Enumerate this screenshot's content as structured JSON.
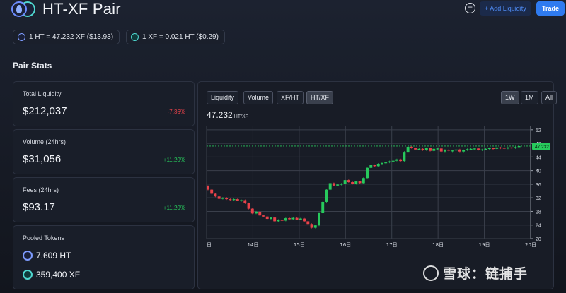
{
  "header": {
    "title": "HT-XF Pair",
    "add_liquidity_label": "+ Add Liquidity",
    "trade_label": "Trade",
    "plus_symbol": "+"
  },
  "rates": {
    "ht_to_xf": "1 HT = 47.232 XF ($13.93)",
    "xf_to_ht": "1 XF = 0.021 HT ($0.29)"
  },
  "section_title": "Pair Stats",
  "stats": {
    "total_liquidity": {
      "label": "Total Liquidity",
      "value": "$212,037",
      "change": "-7.36%"
    },
    "volume": {
      "label": "Volume (24hrs)",
      "value": "$31,056",
      "change": "+11.20%"
    },
    "fees": {
      "label": "Fees (24hrs)",
      "value": "$93.17",
      "change": "+11.20%"
    },
    "pooled": {
      "label": "Pooled Tokens",
      "ht": "7,609 HT",
      "xf": "359,400 XF"
    }
  },
  "chart_tabs": [
    "Liquidity",
    "Volume",
    "XF/HT",
    "HT/XF"
  ],
  "active_tab": "HT/XF",
  "range_tabs": [
    "1W",
    "1M",
    "All"
  ],
  "active_range": "1W",
  "price": {
    "value": "47.232",
    "unit": "HT/XF"
  },
  "watermark": "雪球：链捕手",
  "colors": {
    "up": "#27c95c",
    "down": "#e8424a",
    "accent": "#2f7bf0",
    "current_price": "#27c95c"
  },
  "chart_data": {
    "type": "candlestick",
    "x_ticks": [
      "日",
      "14日",
      "15日",
      "16日",
      "17日",
      "18日",
      "19日",
      "20日"
    ],
    "y_ticks": [
      20,
      24,
      28,
      32,
      36,
      40,
      44,
      48,
      52
    ],
    "ylim": [
      20,
      53
    ],
    "current_price_label": "47.232",
    "current_price": 47.2,
    "grid": true,
    "candles": [
      [
        0.0,
        35.5,
        34.4
      ],
      [
        0.08,
        34.4,
        33.2
      ],
      [
        0.16,
        33.2,
        32.4
      ],
      [
        0.24,
        32.4,
        31.7
      ],
      [
        0.32,
        31.7,
        32.0
      ],
      [
        0.4,
        32.0,
        31.6
      ],
      [
        0.48,
        31.6,
        31.4
      ],
      [
        0.56,
        31.4,
        31.6
      ],
      [
        0.64,
        31.6,
        31.2
      ],
      [
        0.72,
        31.2,
        31.3
      ],
      [
        0.8,
        31.3,
        30.4
      ],
      [
        0.88,
        30.4,
        28.8
      ],
      [
        0.96,
        28.8,
        27.4
      ],
      [
        1.04,
        27.4,
        27.9
      ],
      [
        1.12,
        27.9,
        26.8
      ],
      [
        1.2,
        26.8,
        26.5
      ],
      [
        1.28,
        26.5,
        25.8
      ],
      [
        1.36,
        25.8,
        26.2
      ],
      [
        1.44,
        26.2,
        25.1
      ],
      [
        1.52,
        25.1,
        25.5
      ],
      [
        1.6,
        25.5,
        25.3
      ],
      [
        1.68,
        25.3,
        26.0
      ],
      [
        1.76,
        26.0,
        25.7
      ],
      [
        1.84,
        25.7,
        26.1
      ],
      [
        1.92,
        26.1,
        25.6
      ],
      [
        2.0,
        25.6,
        25.9
      ],
      [
        2.08,
        25.9,
        25.1
      ],
      [
        2.16,
        25.1,
        24.3
      ],
      [
        2.24,
        24.3,
        23.2
      ],
      [
        2.32,
        23.2,
        23.9
      ],
      [
        2.4,
        23.9,
        27.6
      ],
      [
        2.48,
        27.6,
        30.8
      ],
      [
        2.56,
        30.8,
        34.4
      ],
      [
        2.64,
        34.4,
        36.3
      ],
      [
        2.72,
        36.3,
        35.6
      ],
      [
        2.8,
        35.6,
        35.9
      ],
      [
        2.88,
        35.9,
        36.1
      ],
      [
        2.96,
        36.1,
        37.2
      ],
      [
        3.04,
        37.2,
        36.6
      ],
      [
        3.12,
        36.6,
        36.1
      ],
      [
        3.2,
        36.1,
        36.8
      ],
      [
        3.28,
        36.8,
        36.3
      ],
      [
        3.36,
        36.3,
        37.8
      ],
      [
        3.44,
        37.8,
        40.8
      ],
      [
        3.52,
        40.8,
        41.6
      ],
      [
        3.6,
        41.6,
        41.3
      ],
      [
        3.68,
        41.3,
        42.0
      ],
      [
        3.76,
        42.0,
        42.2
      ],
      [
        3.84,
        42.2,
        42.4
      ],
      [
        3.92,
        42.4,
        42.7
      ],
      [
        4.0,
        42.7,
        42.9
      ],
      [
        4.08,
        42.9,
        43.3
      ],
      [
        4.16,
        43.3,
        42.8
      ],
      [
        4.24,
        42.8,
        45.5
      ],
      [
        4.32,
        45.5,
        47.0
      ],
      [
        4.4,
        47.0,
        46.6
      ],
      [
        4.48,
        46.6,
        46.2
      ],
      [
        4.56,
        46.2,
        46.4
      ],
      [
        4.64,
        46.4,
        46.0
      ],
      [
        4.72,
        46.0,
        46.6
      ],
      [
        4.8,
        46.6,
        45.8
      ],
      [
        4.88,
        45.8,
        46.4
      ],
      [
        4.96,
        46.4,
        46.5
      ],
      [
        5.04,
        46.5,
        45.6
      ],
      [
        5.12,
        45.6,
        46.1
      ],
      [
        5.2,
        46.1,
        45.9
      ],
      [
        5.28,
        45.9,
        45.9
      ],
      [
        5.36,
        45.9,
        46.2
      ],
      [
        5.44,
        46.2,
        45.6
      ],
      [
        5.52,
        45.6,
        46.0
      ],
      [
        5.6,
        46.0,
        46.3
      ],
      [
        5.68,
        46.3,
        46.4
      ],
      [
        5.76,
        46.4,
        46.5
      ],
      [
        5.84,
        46.5,
        46.1
      ],
      [
        5.92,
        46.1,
        46.2
      ],
      [
        6.0,
        46.2,
        46.4
      ],
      [
        6.08,
        46.4,
        46.6
      ],
      [
        6.16,
        46.6,
        46.4
      ],
      [
        6.24,
        46.4,
        46.8
      ],
      [
        6.32,
        46.8,
        46.7
      ],
      [
        6.4,
        46.7,
        46.5
      ],
      [
        6.48,
        46.5,
        46.8
      ],
      [
        6.56,
        46.8,
        46.6
      ],
      [
        6.64,
        46.6,
        46.9
      ],
      [
        6.72,
        46.9,
        47.2
      ]
    ]
  }
}
